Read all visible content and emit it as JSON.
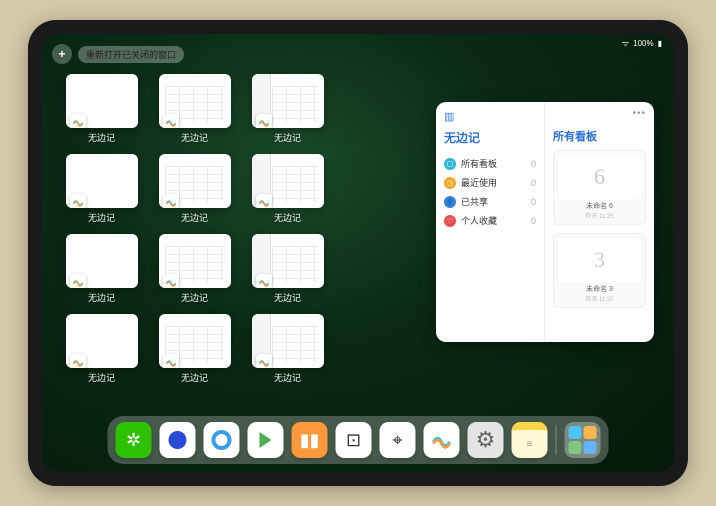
{
  "status": {
    "battery": "100%"
  },
  "controls": {
    "plus": "+",
    "reopen_label": "重新打开已关闭的窗口"
  },
  "app_name": "无边记",
  "windows": [
    {
      "label": "无边记",
      "style": "blank"
    },
    {
      "label": "无边记",
      "style": "grid"
    },
    {
      "label": "无边记",
      "style": "sidebar"
    },
    {
      "label": "无边记",
      "style": "blank"
    },
    {
      "label": "无边记",
      "style": "grid"
    },
    {
      "label": "无边记",
      "style": "sidebar"
    },
    {
      "label": "无边记",
      "style": "blank"
    },
    {
      "label": "无边记",
      "style": "grid"
    },
    {
      "label": "无边记",
      "style": "sidebar"
    },
    {
      "label": "无边记",
      "style": "blank"
    },
    {
      "label": "无边记",
      "style": "grid"
    },
    {
      "label": "无边记",
      "style": "sidebar"
    }
  ],
  "panel": {
    "left_title": "无边记",
    "right_title": "所有看板",
    "items": [
      {
        "icon_color": "#2fb6d6",
        "glyph": "▢",
        "label": "所有看板",
        "count": "0"
      },
      {
        "icon_color": "#f5a623",
        "glyph": "◷",
        "label": "最近使用",
        "count": "0"
      },
      {
        "icon_color": "#3a7fd5",
        "glyph": "👤",
        "label": "已共享",
        "count": "0"
      },
      {
        "icon_color": "#e94f4f",
        "glyph": "♡",
        "label": "个人收藏",
        "count": "0"
      }
    ],
    "boards": [
      {
        "sketch": "6",
        "name": "未命名 6",
        "date": "昨天 11:25"
      },
      {
        "sketch": "3",
        "name": "未命名 3",
        "date": "昨天 11:20"
      }
    ]
  },
  "dock": [
    {
      "name": "wechat",
      "bg": "#2dc100",
      "glyph": "✲"
    },
    {
      "name": "quark",
      "bg": "#ffffff",
      "glyph": "◉"
    },
    {
      "name": "qqbrowser",
      "bg": "#ffffff",
      "glyph": "◯"
    },
    {
      "name": "play",
      "bg": "#ffffff",
      "glyph": "▶"
    },
    {
      "name": "books",
      "bg": "#ff9a3c",
      "glyph": "▮▮"
    },
    {
      "name": "dice",
      "bg": "#ffffff",
      "glyph": "⊡"
    },
    {
      "name": "camera",
      "bg": "#ffffff",
      "glyph": "⌖"
    },
    {
      "name": "freeform",
      "bg": "#ffffff",
      "glyph": "〰"
    },
    {
      "name": "settings",
      "bg": "#e4e4e4",
      "glyph": "⚙"
    },
    {
      "name": "notes",
      "bg": "#fff8d6",
      "glyph": "≡"
    }
  ]
}
